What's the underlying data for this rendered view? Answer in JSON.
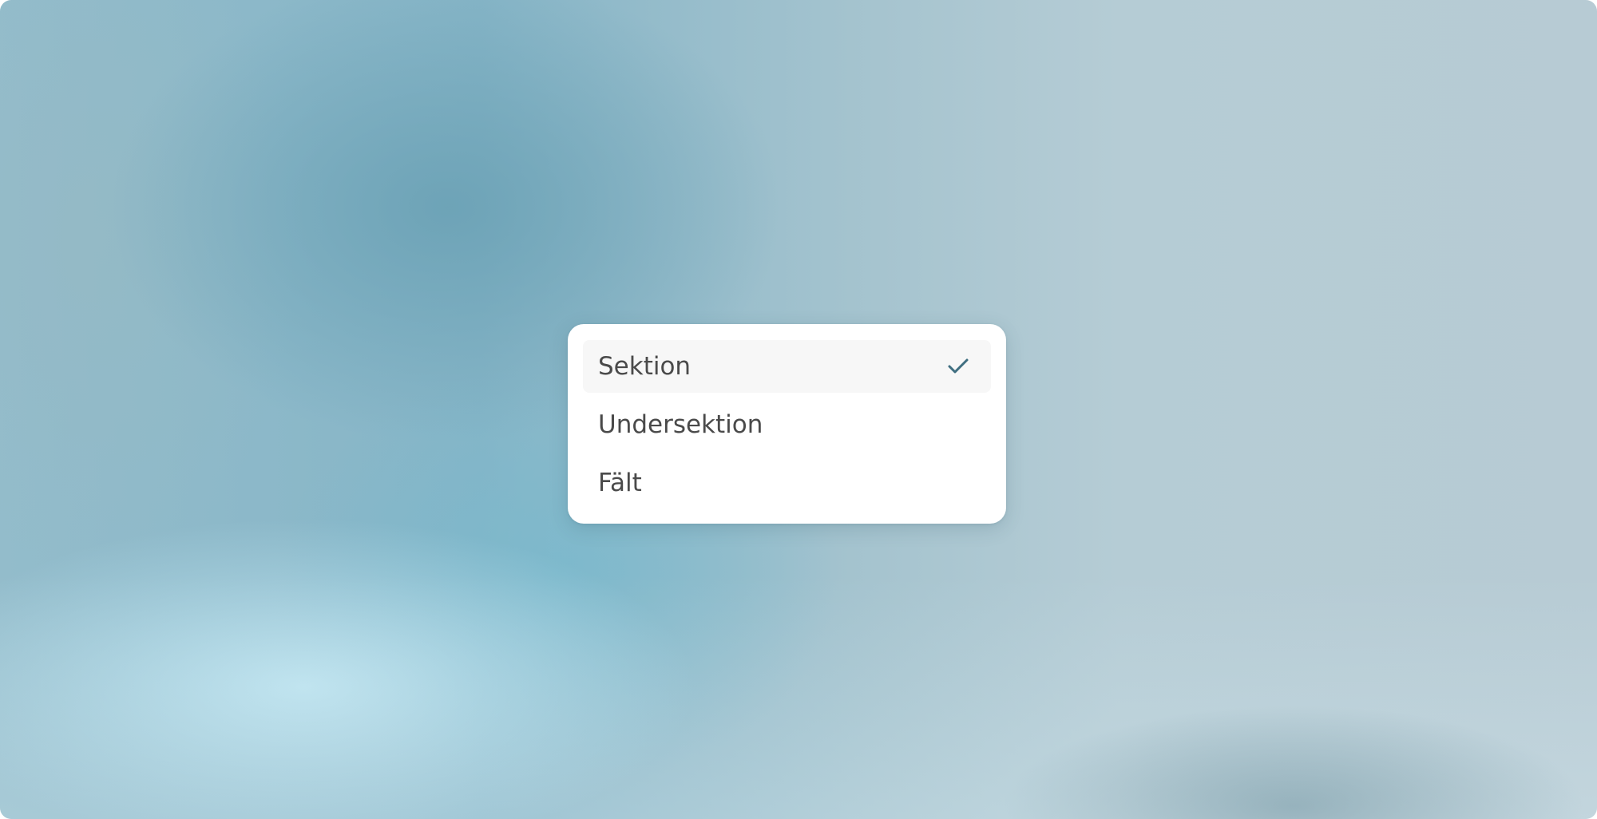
{
  "dropdown": {
    "items": [
      {
        "label": "Sektion",
        "selected": true
      },
      {
        "label": "Undersektion",
        "selected": false
      },
      {
        "label": "Fält",
        "selected": false
      }
    ],
    "check_icon": "checkmark-icon",
    "check_color": "#3f6e80"
  }
}
